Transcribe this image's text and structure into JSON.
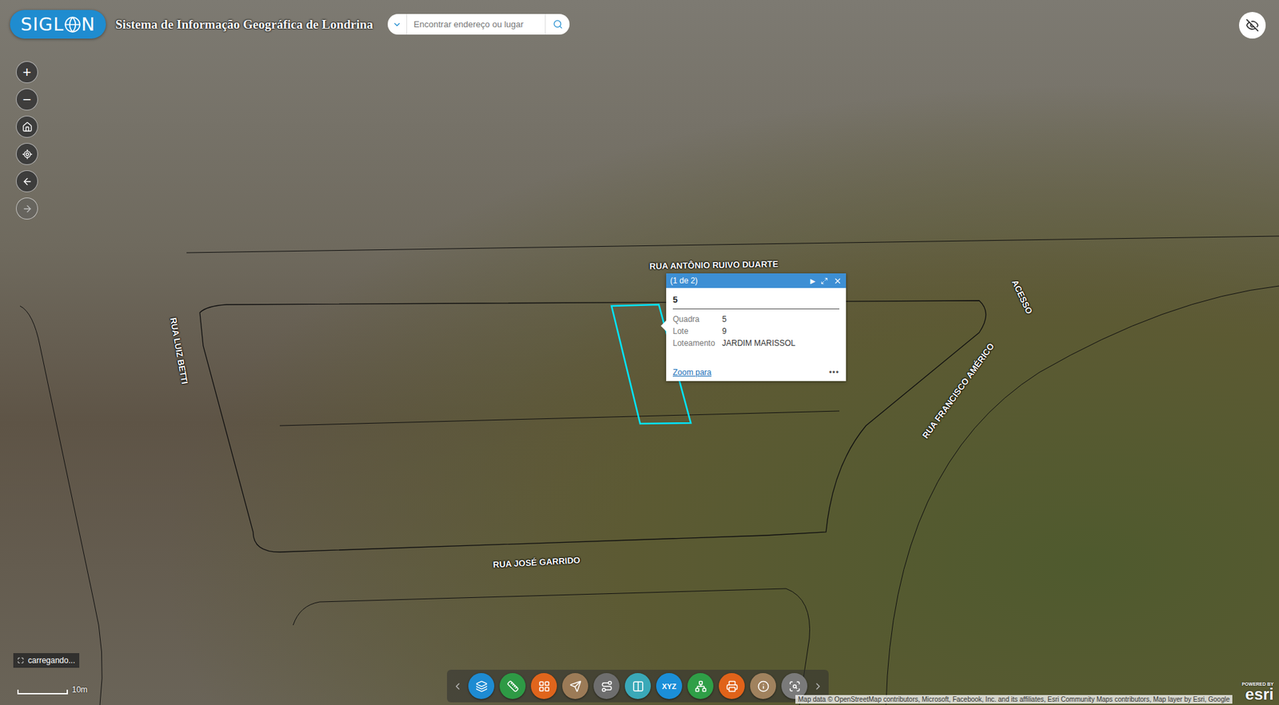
{
  "header": {
    "logo_left": "SIGL",
    "logo_right": "N",
    "title": "Sistema de Informação Geográfica de Londrina"
  },
  "search": {
    "placeholder": "Encontrar endereço ou lugar"
  },
  "nav_buttons": [
    {
      "kind": "text",
      "label": "+",
      "disabled": false
    },
    {
      "kind": "text",
      "label": "−",
      "disabled": false
    },
    {
      "kind": "home",
      "disabled": false
    },
    {
      "kind": "locate",
      "disabled": false
    },
    {
      "kind": "back",
      "disabled": false
    },
    {
      "kind": "forward",
      "disabled": true
    }
  ],
  "popup": {
    "pager": "(1 de 2)",
    "next": "▶",
    "title": "5",
    "fields": [
      {
        "label": "Quadra",
        "value": "5"
      },
      {
        "label": "Lote",
        "value": "9"
      },
      {
        "label": "Loteamento",
        "value": "JARDIM MARISSOL"
      }
    ],
    "link": "Zoom para",
    "more": "•••"
  },
  "map_labels": [
    {
      "text": "RUA ANTÔNIO RUIVO DUARTE"
    },
    {
      "text": "RUA LUIZ BETTI"
    },
    {
      "text": "ACESSO"
    },
    {
      "text": "RUA FRANCISCO AMÉRICO"
    },
    {
      "text": "RUA JOSÉ GARRIDO"
    }
  ],
  "loading": {
    "text": "carregando..."
  },
  "scale": {
    "label": "10m"
  },
  "toolbar": {
    "tools": [
      {
        "kind": "layers",
        "color": "#1e8bd2"
      },
      {
        "kind": "ruler",
        "color": "#2e9a45"
      },
      {
        "kind": "grid",
        "color": "#e0651c"
      },
      {
        "kind": "send",
        "color": "#9c7b57"
      },
      {
        "kind": "route",
        "color": "#6e6e6e"
      },
      {
        "kind": "compare",
        "color": "#3aa9b8"
      },
      {
        "kind": "xyz",
        "label": "XYZ",
        "color": "#1b8fd8"
      },
      {
        "kind": "network",
        "color": "#2f9f47"
      },
      {
        "kind": "print",
        "color": "#e0631a"
      },
      {
        "kind": "info",
        "color": "#a0825e"
      },
      {
        "kind": "inspect",
        "color": "#7a7a7a"
      }
    ]
  },
  "attribution": "Map data © OpenStreetMap contributors, Microsoft, Facebook, Inc. and its affiliates, Esri Community Maps contributors, Map layer by Esri, Google",
  "esri": {
    "powered": "POWERED BY",
    "brand": "esri"
  }
}
